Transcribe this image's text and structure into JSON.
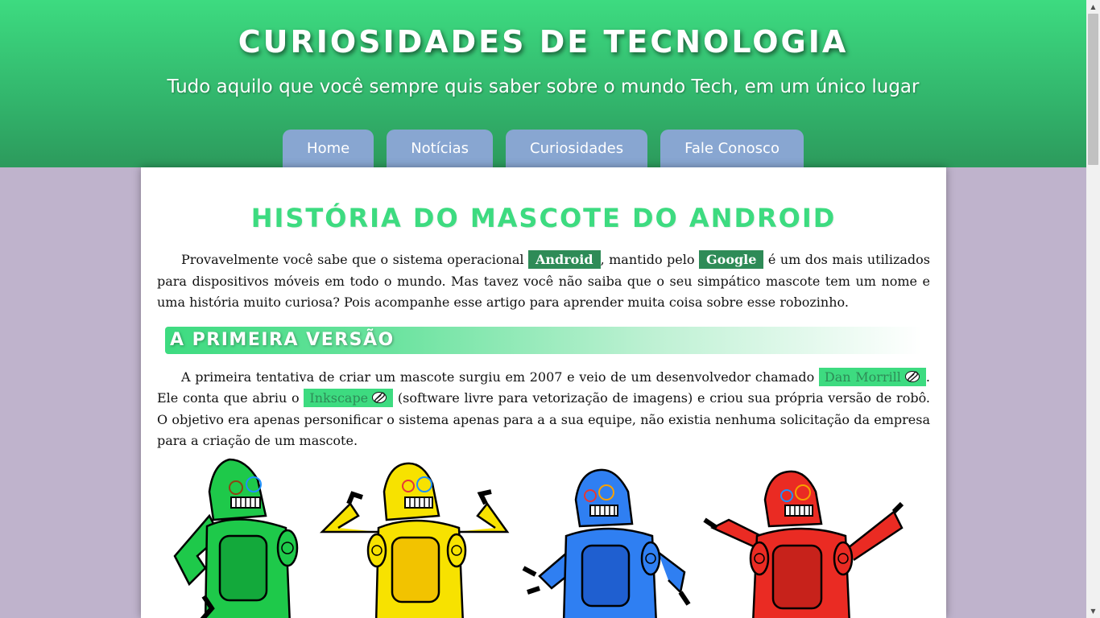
{
  "header": {
    "title": "CURIOSIDADES DE TECNOLOGIA",
    "subtitle": "Tudo aquilo que você sempre quis saber sobre o mundo Tech, em um único lugar"
  },
  "nav": {
    "items": [
      {
        "label": "Home"
      },
      {
        "label": "Notícias"
      },
      {
        "label": "Curiosidades"
      },
      {
        "label": "Fale Conosco"
      }
    ]
  },
  "article": {
    "title": "HISTÓRIA DO MASCOTE DO ANDROID",
    "intro": {
      "part1": "Provavelmente você sabe que o sistema operacional ",
      "highlight1": "Android",
      "part2": ", mantido pelo ",
      "highlight2": "Google",
      "part3": " é um dos mais utilizados para dispositivos móveis em todo o mundo. Mas tavez você não saiba que o seu simpático mascote tem um nome e uma história muito curiosa? Pois acompanhe esse artigo para aprender muita coisa sobre esse robozinho."
    },
    "section1": {
      "title": "A PRIMEIRA VERSÃO",
      "part1": "A primeira tentativa de criar um mascote surgiu em 2007 e veio de um desenvolvedor chamado ",
      "link1": "Dan Morrill",
      "part2": ". Ele conta que abriu o ",
      "link2": "Inkscape",
      "part3": " (software livre para vetorização de imagens) e criou sua própria versão de robô. O objetivo era apenas personificar o sistema apenas para a a sua equipe, não existia nenhuma solicitação da empresa para a criação de um mascote."
    },
    "robots": [
      {
        "color": "#1ec94a"
      },
      {
        "color": "#f7e200"
      },
      {
        "color": "#2f7ff2"
      },
      {
        "color": "#ea2b23"
      }
    ]
  },
  "colors": {
    "header_green": "#3ddb80",
    "nav_blue": "#88a6d1",
    "highlight_dark_green": "#2e8b57",
    "background_lavender": "#bfb3cc"
  }
}
